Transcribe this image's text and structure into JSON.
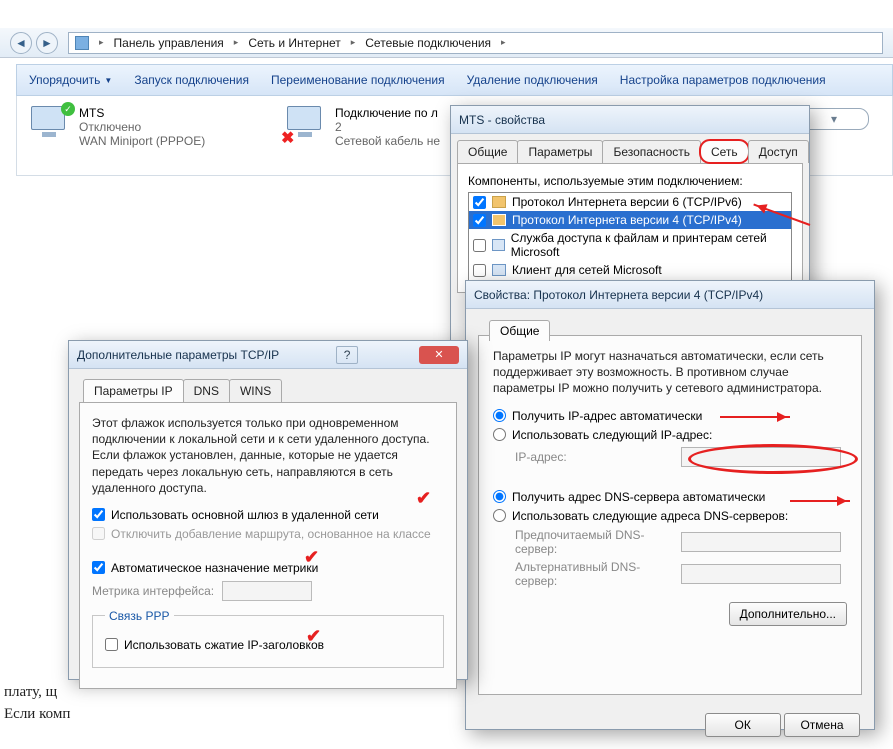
{
  "breadcrumbs": {
    "a": "Панель управления",
    "b": "Сеть и Интернет",
    "c": "Сетевые подключения"
  },
  "toolbar": {
    "organize": "Упорядочить",
    "start": "Запуск подключения",
    "rename": "Переименование подключения",
    "delete": "Удаление подключения",
    "settings": "Настройка параметров подключения"
  },
  "conn1": {
    "title": "MTS",
    "status": "Отключено",
    "device": "WAN Miniport (PPPOE)"
  },
  "conn2": {
    "title": "Подключение по л",
    "status": "2",
    "device": "Сетевой кабель не"
  },
  "winMTS": {
    "title": "MTS - свойства",
    "tabs": {
      "general": "Общие",
      "params": "Параметры",
      "security": "Безопасность",
      "net": "Сеть",
      "access": "Доступ"
    },
    "compLabel": "Компоненты, используемые этим подключением:",
    "items": {
      "ipv6": "Протокол Интернета версии 6 (TCP/IPv6)",
      "ipv4": "Протокол Интернета версии 4 (TCP/IPv4)",
      "files": "Служба доступа к файлам и принтерам сетей Microsoft",
      "client": "Клиент для сетей Microsoft"
    }
  },
  "winIPv4": {
    "title": "Свойства: Протокол Интернета версии 4 (TCP/IPv4)",
    "tab": "Общие",
    "desc": "Параметры IP могут назначаться автоматически, если сеть поддерживает эту возможность. В противном случае параметры IP можно получить у сетевого администратора.",
    "optAutoIP": "Получить IP-адрес автоматически",
    "optManualIP": "Использовать следующий IP-адрес:",
    "lblIP": "IP-адрес:",
    "optAutoDNS": "Получить адрес DNS-сервера автоматически",
    "optManualDNS": "Использовать следующие адреса DNS-серверов:",
    "lblDNS1": "Предпочитаемый DNS-сервер:",
    "lblDNS2": "Альтернативный DNS-сервер:",
    "btnAdv": "Дополнительно...",
    "btnOK": "ОК",
    "btnCancel": "Отмена"
  },
  "winAdv": {
    "title": "Дополнительные параметры TCP/IP",
    "tabs": {
      "ip": "Параметры IP",
      "dns": "DNS",
      "wins": "WINS"
    },
    "desc": "Этот флажок используется только при одновременном подключении к локальной сети и к сети удаленного доступа. Если флажок установлен, данные, которые не удается передать через локальную сеть, направляются в сеть удаленного доступа.",
    "chkGateway": "Использовать основной шлюз в удаленной сети",
    "chkRoute": "Отключить добавление маршрута, основанное на классе",
    "chkMetric": "Автоматическое назначение метрики",
    "lblMetric": "Метрика интерфейса:",
    "groupPPP": "Связь PPP",
    "chkPPP": "Использовать сжатие IP-заголовков"
  },
  "bg": {
    "t1": "плату, щ",
    "t2": "Если комп"
  }
}
